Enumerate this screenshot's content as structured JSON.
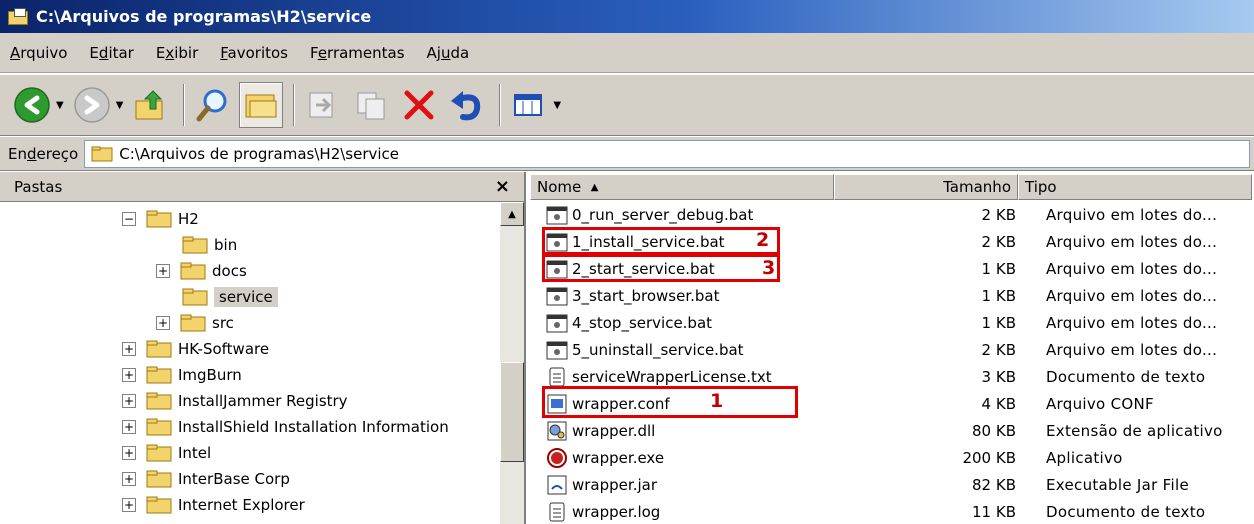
{
  "window": {
    "title": "C:\\Arquivos de programas\\H2\\service"
  },
  "menu": [
    {
      "pre": "",
      "u": "A",
      "post": "rquivo"
    },
    {
      "pre": "E",
      "u": "d",
      "post": "itar"
    },
    {
      "pre": "E",
      "u": "x",
      "post": "ibir"
    },
    {
      "pre": "",
      "u": "F",
      "post": "avoritos"
    },
    {
      "pre": "F",
      "u": "e",
      "post": "rramentas"
    },
    {
      "pre": "Aj",
      "u": "u",
      "post": "da"
    }
  ],
  "address": {
    "label_pre": "En",
    "label_u": "d",
    "label_post": "ereço",
    "value": "C:\\Arquivos de programas\\H2\\service"
  },
  "folders": {
    "title": "Pastas",
    "close": "×",
    "items": [
      {
        "label": "H2",
        "exp": "⊟"
      },
      {
        "label": "bin",
        "exp": ""
      },
      {
        "label": "docs",
        "exp": "⊞"
      },
      {
        "label": "service",
        "exp": ""
      },
      {
        "label": "src",
        "exp": "⊞"
      },
      {
        "label": "HK-Software",
        "exp": "⊞"
      },
      {
        "label": "ImgBurn",
        "exp": "⊞"
      },
      {
        "label": "InstallJammer Registry",
        "exp": "⊞"
      },
      {
        "label": "InstallShield Installation Information",
        "exp": "⊞"
      },
      {
        "label": "Intel",
        "exp": "⊞"
      },
      {
        "label": "InterBase Corp",
        "exp": "⊞"
      },
      {
        "label": "Internet Explorer",
        "exp": "⊞"
      }
    ]
  },
  "columns": {
    "name": "Nome",
    "sort_indicator": "▲",
    "size": "Tamanho",
    "type": "Tipo"
  },
  "files": [
    {
      "name": "0_run_server_debug.bat",
      "size": "2 KB",
      "type": "Arquivo em lotes do...",
      "icon": "batch-file-icon"
    },
    {
      "name": "1_install_service.bat",
      "size": "2 KB",
      "type": "Arquivo em lotes do...",
      "icon": "batch-file-icon"
    },
    {
      "name": "2_start_service.bat",
      "size": "1 KB",
      "type": "Arquivo em lotes do...",
      "icon": "batch-file-icon"
    },
    {
      "name": "3_start_browser.bat",
      "size": "1 KB",
      "type": "Arquivo em lotes do...",
      "icon": "batch-file-icon"
    },
    {
      "name": "4_stop_service.bat",
      "size": "1 KB",
      "type": "Arquivo em lotes do...",
      "icon": "batch-file-icon"
    },
    {
      "name": "5_uninstall_service.bat",
      "size": "2 KB",
      "type": "Arquivo em lotes do...",
      "icon": "batch-file-icon"
    },
    {
      "name": "serviceWrapperLicense.txt",
      "size": "3 KB",
      "type": "Documento de texto",
      "icon": "text-file-icon"
    },
    {
      "name": "wrapper.conf",
      "size": "4 KB",
      "type": "Arquivo CONF",
      "icon": "conf-file-icon"
    },
    {
      "name": "wrapper.dll",
      "size": "80 KB",
      "type": "Extensão de aplicativo",
      "icon": "dll-file-icon"
    },
    {
      "name": "wrapper.exe",
      "size": "200 KB",
      "type": "Aplicativo",
      "icon": "exe-file-icon"
    },
    {
      "name": "wrapper.jar",
      "size": "82 KB",
      "type": "Executable Jar File",
      "icon": "jar-file-icon"
    },
    {
      "name": "wrapper.log",
      "size": "11 KB",
      "type": "Documento de texto",
      "icon": "text-file-icon"
    }
  ],
  "annotations": {
    "mark_install": "2",
    "mark_start": "3",
    "mark_conf": "1",
    "color": "#e00000"
  }
}
